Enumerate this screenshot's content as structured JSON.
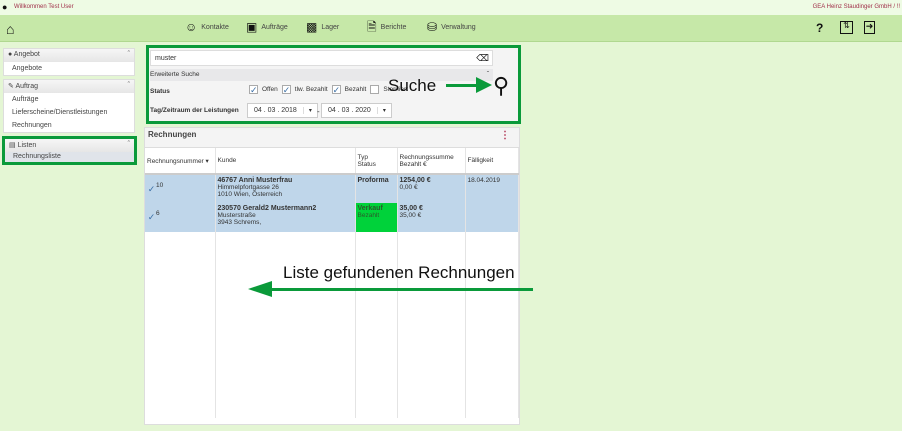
{
  "topbar": {
    "welcome": "Willkommen Test User",
    "company": "GEA Heinz Staudinger GmbH / !!"
  },
  "nav": {
    "items": [
      {
        "label": "Kontakte",
        "icon": "contacts-icon"
      },
      {
        "label": "Aufträge",
        "icon": "orders-icon"
      },
      {
        "label": "Lager",
        "icon": "warehouse-icon"
      },
      {
        "label": "Berichte",
        "icon": "reports-icon"
      },
      {
        "label": "Verwaltung",
        "icon": "admin-icon"
      }
    ],
    "help": "?"
  },
  "sidebar": [
    {
      "title": "Angebot",
      "items": [
        "Angebote"
      ]
    },
    {
      "title": "Auftrag",
      "items": [
        "Aufträge",
        "Lieferscheine/Dienstleistungen",
        "Rechnungen"
      ]
    },
    {
      "title": "Listen",
      "items": [
        "Rechnungsliste"
      ]
    }
  ],
  "search": {
    "value": "muster",
    "advanced": "Erweiterte Suche",
    "status_label": "Status",
    "statuses": [
      {
        "label": "Offen",
        "checked": true
      },
      {
        "label": "tlw. Bezahlt",
        "checked": true
      },
      {
        "label": "Bezahlt",
        "checked": true
      },
      {
        "label": "Storniert",
        "checked": false
      }
    ],
    "period_label": "Tag/Zeitraum der Leistungen",
    "from": "04 . 03 . 2018",
    "to": "04 . 03 . 2020",
    "sep": "-"
  },
  "table": {
    "title": "Rechnungen",
    "headers": [
      "Rechnungsnummer",
      "Kunde",
      "Typ",
      "Status",
      "Rechnungssumme",
      "Bezahlt €",
      "Fälligkeit"
    ],
    "rows": [
      {
        "nr": "10",
        "kunde": "46767 Anni Musterfrau",
        "addr1": "Himmelpfortgasse 26",
        "addr2": "1010 Wien, Österreich",
        "typ": "Proforma",
        "status": "",
        "summe": "1254,00 €",
        "bezahlt": "0,00 €",
        "faellig": "18.04.2019"
      },
      {
        "nr": "6",
        "kunde": "230570 Gerald2 Mustermann2",
        "addr1": "Musterstraße",
        "addr2": "3943 Schrems,",
        "typ": "Verkauf",
        "status": "Bezahlt",
        "summe": "35,00 €",
        "bezahlt": "35,00 €",
        "faellig": ""
      }
    ]
  },
  "annotations": {
    "search": "Suche",
    "list": "Liste gefundenen Rechnungen"
  },
  "colors": {
    "highlight": "#0a9a3a",
    "paid": "#00d23a",
    "row": "#bfd6ea"
  }
}
